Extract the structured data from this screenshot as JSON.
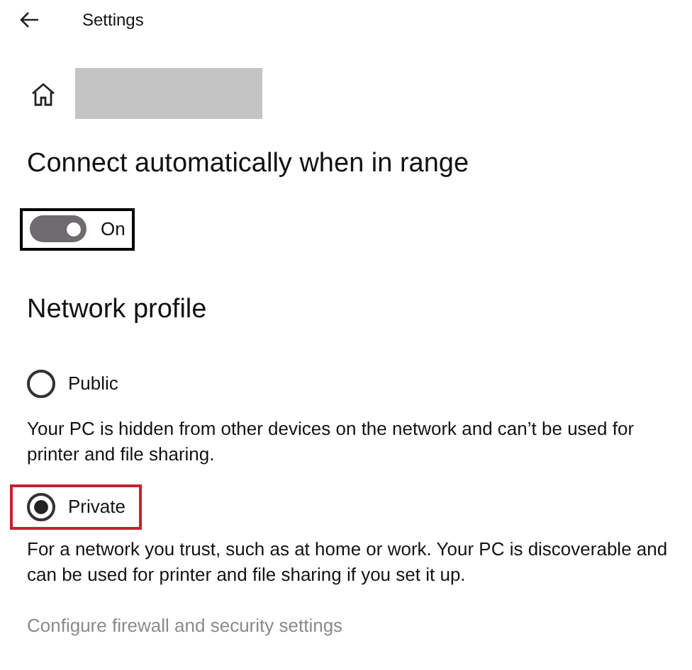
{
  "header": {
    "title": "Settings"
  },
  "connect": {
    "heading": "Connect automatically when in range",
    "toggle": {
      "on": true,
      "focused": true,
      "label": "On"
    }
  },
  "profile": {
    "heading": "Network profile",
    "options": [
      {
        "label": "Public",
        "selected": false,
        "highlighted": false,
        "description": "Your PC is hidden from other devices on the network and can’t be used for printer and file sharing."
      },
      {
        "label": "Private",
        "selected": true,
        "highlighted": true,
        "description": "For a network you trust, such as at home or work. Your PC is discoverable and can be used for printer and file sharing if you set it up."
      }
    ],
    "link": "Configure firewall and security settings"
  }
}
